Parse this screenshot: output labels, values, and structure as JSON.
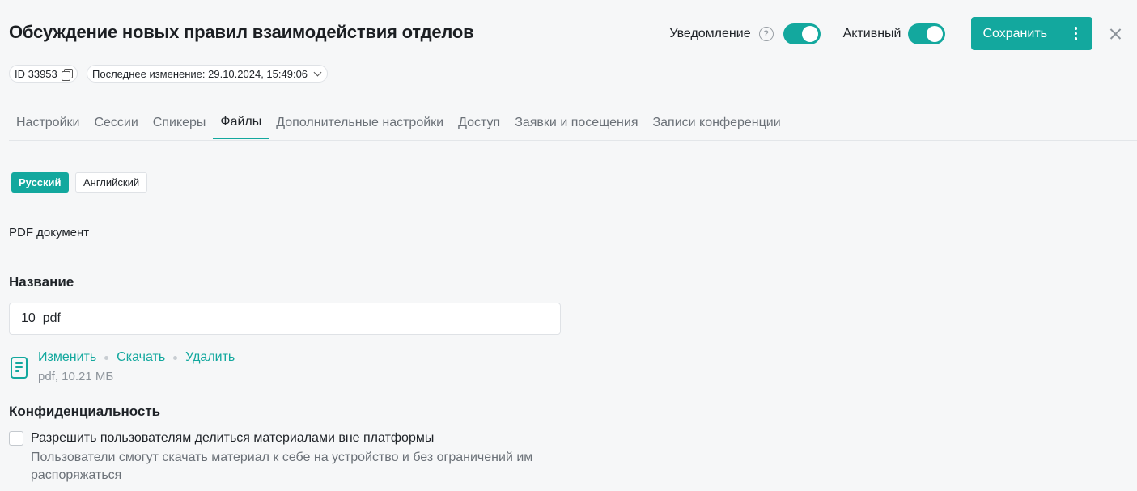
{
  "header": {
    "title": "Обсуждение новых правил взаимодействия отделов",
    "notification_label": "Уведомление",
    "notification_on": true,
    "active_label": "Активный",
    "active_on": true,
    "save_label": "Сохранить",
    "help_glyph": "?",
    "icons": [
      "help-icon",
      "more-vertical-icon",
      "close-icon"
    ]
  },
  "meta": {
    "id_label": "ID 33953",
    "last_modified": "Последнее изменение: 29.10.2024, 15:49:06",
    "icons": [
      "copy-icon",
      "chevron-down-icon"
    ]
  },
  "tabs": [
    {
      "label": "Настройки",
      "active": false
    },
    {
      "label": "Сессии",
      "active": false
    },
    {
      "label": "Спикеры",
      "active": false
    },
    {
      "label": "Файлы",
      "active": true
    },
    {
      "label": "Дополнительные настройки",
      "active": false
    },
    {
      "label": "Доступ",
      "active": false
    },
    {
      "label": "Заявки и посещения",
      "active": false
    },
    {
      "label": "Записи конференции",
      "active": false
    }
  ],
  "languages": [
    {
      "label": "Русский",
      "active": true
    },
    {
      "label": "Английский",
      "active": false
    }
  ],
  "content": {
    "doc_type": "PDF документ",
    "name_heading": "Название",
    "name_value": "10  pdf",
    "file": {
      "icon": "document-icon",
      "actions": [
        "Изменить",
        "Скачать",
        "Удалить"
      ],
      "meta": "pdf, 10.21 МБ"
    },
    "privacy_heading": "Конфиденциальность",
    "share_checkbox_checked": false,
    "share_label": "Разрешить пользователям делиться материалами вне платформы",
    "share_description": "Пользователи смогут скачать материал к себе на устройство и без ограничений им распоряжаться"
  },
  "colors": {
    "accent": "#13a89e",
    "background": "#f6f7f8",
    "muted_text": "#6b7178"
  }
}
